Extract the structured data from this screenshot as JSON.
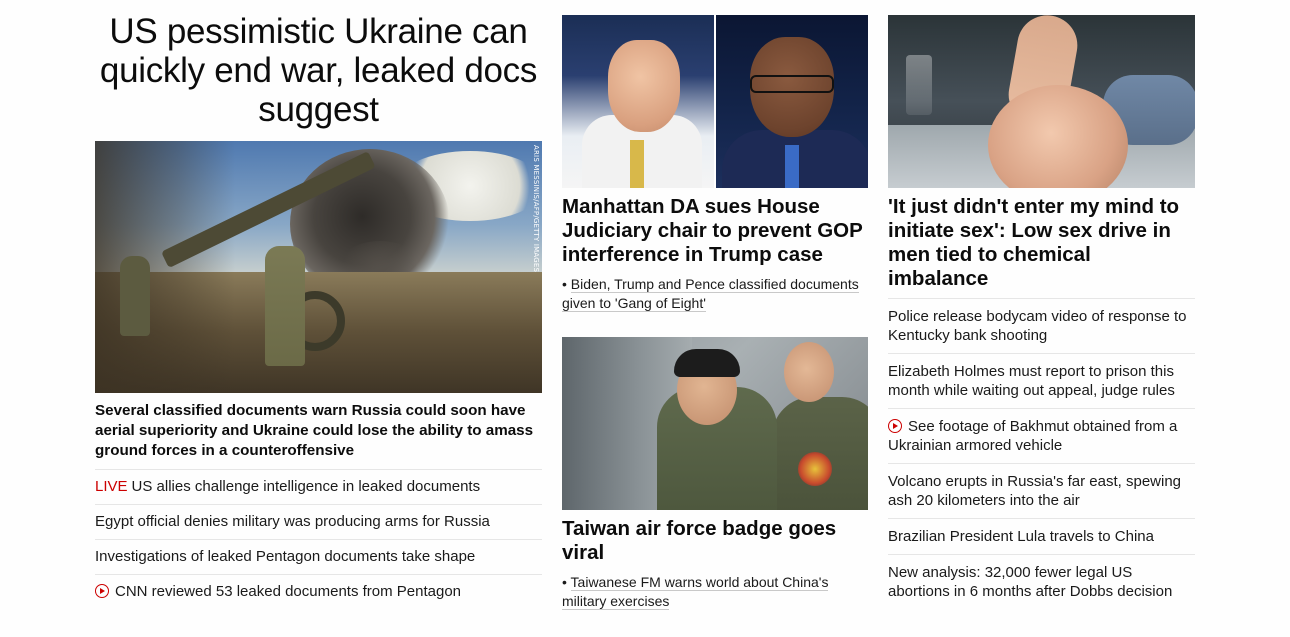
{
  "col1": {
    "headline": "US pessimistic Ukraine can quickly end war, leaked docs suggest",
    "image_credit": "ARIS MESSINIS/AFP/GETTY IMAGES",
    "lead_description": "Several classified documents warn Russia could soon have aerial superiority and Ukraine could lose the ability to amass ground forces in a counteroffensive",
    "items": [
      {
        "tag": "LIVE",
        "text": "US allies challenge intelligence in leaked documents"
      },
      {
        "text": "Egypt official denies military was producing arms for Russia"
      },
      {
        "text": "Investigations of leaked Pentagon documents take shape"
      },
      {
        "icon": "play-icon",
        "text": "CNN reviewed 53 leaked documents from Pentagon"
      }
    ]
  },
  "col2": {
    "story1": {
      "headline": "Manhattan DA sues House Judiciary chair to prevent GOP interference in Trump case",
      "bullet": "Biden, Trump and Pence classified documents given to 'Gang of Eight'"
    },
    "story2": {
      "headline": "Taiwan air force badge goes viral",
      "bullet": "Taiwanese FM warns world about China's military exercises"
    }
  },
  "col3": {
    "headline": "'It just didn't enter my mind to initiate sex': Low sex drive in men tied to chemical imbalance",
    "items": [
      {
        "text": "Police release bodycam video of response to Kentucky bank shooting"
      },
      {
        "text": "Elizabeth Holmes must report to prison this month while waiting out appeal, judge rules"
      },
      {
        "icon": "play-icon",
        "text": "See footage of Bakhmut obtained from a Ukrainian armored vehicle"
      },
      {
        "text": "Volcano erupts in Russia's far east, spewing ash 20 kilometers into the air"
      },
      {
        "text": "Brazilian President Lula travels to China"
      },
      {
        "text": "New analysis: 32,000 fewer legal US abortions in 6 months after Dobbs decision"
      }
    ]
  },
  "colors": {
    "live_red": "#cc0000",
    "text": "#0c0c0c",
    "divider": "#e6e6e6"
  }
}
